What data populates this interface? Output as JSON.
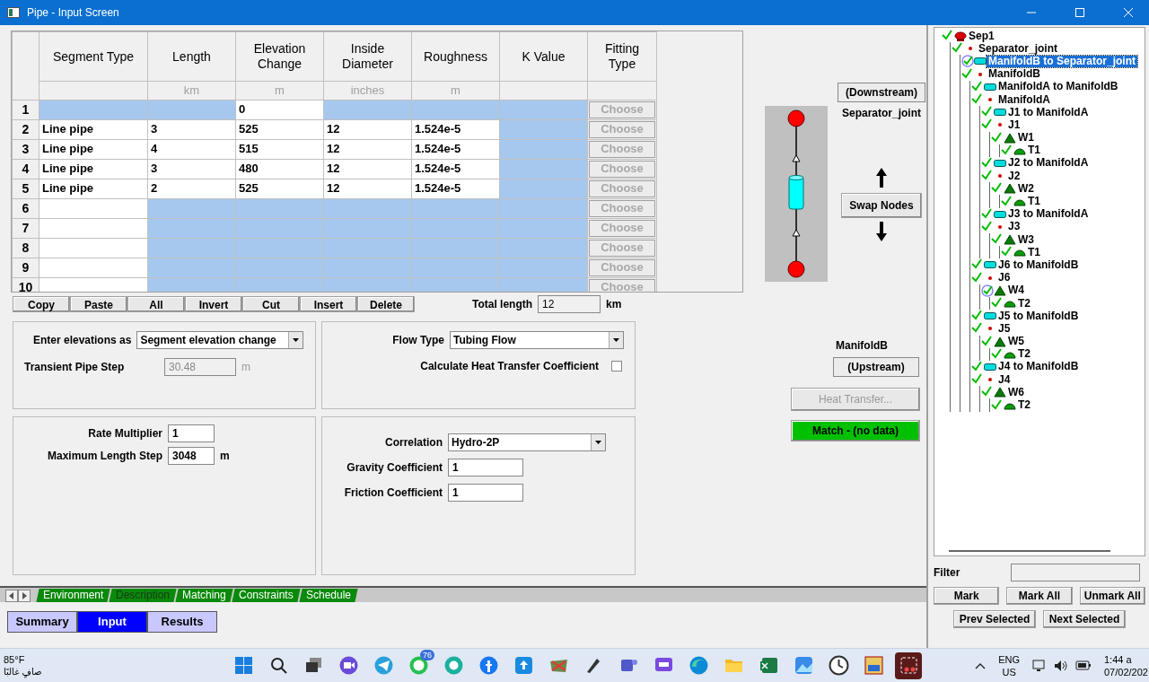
{
  "window": {
    "title": "Pipe - Input Screen"
  },
  "grid": {
    "columns": [
      {
        "title": "Segment Type"
      },
      {
        "title": "Length",
        "unit": "km"
      },
      {
        "title": "Elevation Change",
        "unit": "m"
      },
      {
        "title": "Inside Diameter",
        "unit": "inches"
      },
      {
        "title": "Roughness",
        "unit": "m"
      },
      {
        "title": "K Value"
      },
      {
        "title": "Fitting Type"
      }
    ],
    "rows": [
      {
        "number": "1",
        "cells": [
          {
            "disabled": true
          },
          {
            "disabled": true
          },
          {
            "value": "0",
            "disabled": false
          },
          {
            "disabled": true
          },
          {
            "disabled": true
          },
          {
            "disabled": true
          }
        ],
        "fitting": {
          "label": "Choose",
          "disabled": true
        }
      },
      {
        "number": "2",
        "cells": [
          {
            "value": "Line pipe",
            "disabled": false
          },
          {
            "value": "3",
            "disabled": false
          },
          {
            "value": "525",
            "disabled": false
          },
          {
            "value": "12",
            "disabled": false
          },
          {
            "value": "1.524e-5",
            "disabled": false
          },
          {
            "disabled": true
          }
        ],
        "fitting": {
          "label": "Choose",
          "disabled": true
        }
      },
      {
        "number": "3",
        "cells": [
          {
            "value": "Line pipe",
            "disabled": false
          },
          {
            "value": "4",
            "disabled": false
          },
          {
            "value": "515",
            "disabled": false
          },
          {
            "value": "12",
            "disabled": false
          },
          {
            "value": "1.524e-5",
            "disabled": false
          },
          {
            "disabled": true
          }
        ],
        "fitting": {
          "label": "Choose",
          "disabled": true
        }
      },
      {
        "number": "4",
        "cells": [
          {
            "value": "Line pipe",
            "disabled": false
          },
          {
            "value": "3",
            "disabled": false
          },
          {
            "value": "480",
            "disabled": false
          },
          {
            "value": "12",
            "disabled": false
          },
          {
            "value": "1.524e-5",
            "disabled": false
          },
          {
            "disabled": true
          }
        ],
        "fitting": {
          "label": "Choose",
          "disabled": true
        }
      },
      {
        "number": "5",
        "cells": [
          {
            "value": "Line pipe",
            "disabled": false
          },
          {
            "value": "2",
            "disabled": false
          },
          {
            "value": "525",
            "disabled": false
          },
          {
            "value": "12",
            "disabled": false
          },
          {
            "value": "1.524e-5",
            "disabled": false
          },
          {
            "disabled": true
          }
        ],
        "fitting": {
          "label": "Choose",
          "disabled": true
        }
      },
      {
        "number": "6",
        "cells": [
          {
            "disabled": false
          },
          {
            "disabled": true
          },
          {
            "disabled": true
          },
          {
            "disabled": true
          },
          {
            "disabled": true
          },
          {
            "disabled": true
          }
        ],
        "fitting": {
          "label": "Choose",
          "disabled": true
        }
      },
      {
        "number": "7",
        "cells": [
          {
            "disabled": false
          },
          {
            "disabled": true
          },
          {
            "disabled": true
          },
          {
            "disabled": true
          },
          {
            "disabled": true
          },
          {
            "disabled": true
          }
        ],
        "fitting": {
          "label": "Choose",
          "disabled": true
        }
      },
      {
        "number": "8",
        "cells": [
          {
            "disabled": false
          },
          {
            "disabled": true
          },
          {
            "disabled": true
          },
          {
            "disabled": true
          },
          {
            "disabled": true
          },
          {
            "disabled": true
          }
        ],
        "fitting": {
          "label": "Choose",
          "disabled": true
        }
      },
      {
        "number": "9",
        "cells": [
          {
            "disabled": false
          },
          {
            "disabled": true
          },
          {
            "disabled": true
          },
          {
            "disabled": true
          },
          {
            "disabled": true
          },
          {
            "disabled": true
          }
        ],
        "fitting": {
          "label": "Choose",
          "disabled": true
        }
      },
      {
        "number": "10",
        "cells": [
          {
            "disabled": false
          },
          {
            "disabled": true
          },
          {
            "disabled": true
          },
          {
            "disabled": true
          },
          {
            "disabled": true
          },
          {
            "disabled": true
          }
        ],
        "fitting": {
          "label": "Choose",
          "disabled": true
        }
      }
    ]
  },
  "grid_tools": [
    "Copy",
    "Paste",
    "All",
    "Invert",
    "Cut",
    "Insert",
    "Delete"
  ],
  "total_length": {
    "label": "Total length",
    "value": "12",
    "unit": "km"
  },
  "nodes": {
    "downstream_label": "(Downstream)",
    "downstream": "Separator_joint",
    "swap": "Swap Nodes",
    "upstream": "ManifoldB",
    "upstream_label": "(Upstream)",
    "heat_transfer": {
      "label": "Heat Transfer...",
      "disabled": true
    },
    "match": {
      "label": "Match - (no data)"
    }
  },
  "elevation_panel": {
    "mode_label": "Enter elevations as",
    "mode": "Segment elevation change",
    "step_label": "Transient Pipe Step",
    "step": "30.48",
    "step_unit": "m",
    "step_disabled": true
  },
  "flow_panel": {
    "flow_label": "Flow Type",
    "flow": "Tubing Flow",
    "heat_label": "Calculate Heat Transfer Coefficient",
    "heat_checked": false
  },
  "rate_panel": {
    "rate_label": "Rate Multiplier",
    "rate": "1",
    "step_label": "Maximum Length Step",
    "step": "3048",
    "step_unit": "m"
  },
  "correlation_panel": {
    "correlation_label": "Correlation",
    "correlation": "Hydro-2P",
    "gravity_label": "Gravity Coefficient",
    "gravity": "1",
    "friction_label": "Friction Coefficient",
    "friction": "1"
  },
  "sheet_tabs": [
    {
      "label": "Environment",
      "selected": false
    },
    {
      "label": "Description",
      "selected": true
    },
    {
      "label": "Matching",
      "selected": false
    },
    {
      "label": "Constraints",
      "selected": false
    },
    {
      "label": "Schedule",
      "selected": false
    }
  ],
  "view_buttons": [
    {
      "label": "Summary",
      "selected": false
    },
    {
      "label": "Input",
      "selected": true
    },
    {
      "label": "Results",
      "selected": false
    }
  ],
  "tree": [
    {
      "label": "Sep1",
      "kind": "separator",
      "checked": true,
      "marked": false,
      "selected": false,
      "children": [
        {
          "label": "Separator_joint",
          "kind": "joint",
          "checked": true,
          "marked": false,
          "selected": false,
          "children": [
            {
              "label": "ManifoldB to Separator_joint",
              "kind": "pipe",
              "checked": true,
              "marked": true,
              "selected": true
            },
            {
              "label": "ManifoldB",
              "kind": "joint",
              "checked": true,
              "marked": false,
              "selected": false,
              "children": [
                {
                  "label": "ManifoldA to ManifoldB",
                  "kind": "pipe",
                  "checked": true,
                  "marked": false,
                  "selected": false
                },
                {
                  "label": "ManifoldA",
                  "kind": "joint",
                  "checked": true,
                  "marked": false,
                  "selected": false,
                  "children": [
                    {
                      "label": "J1 to ManifoldA",
                      "kind": "pipe",
                      "checked": true,
                      "marked": false,
                      "selected": false
                    },
                    {
                      "label": "J1",
                      "kind": "joint",
                      "checked": true,
                      "marked": false,
                      "selected": false,
                      "children": [
                        {
                          "label": "W1",
                          "kind": "well",
                          "checked": true,
                          "marked": false,
                          "selected": false,
                          "children": [
                            {
                              "label": "T1",
                              "kind": "tank",
                              "checked": true,
                              "marked": false,
                              "selected": false
                            }
                          ]
                        }
                      ]
                    },
                    {
                      "label": "J2 to ManifoldA",
                      "kind": "pipe",
                      "checked": true,
                      "marked": false,
                      "selected": false
                    },
                    {
                      "label": "J2",
                      "kind": "joint",
                      "checked": true,
                      "marked": false,
                      "selected": false,
                      "children": [
                        {
                          "label": "W2",
                          "kind": "well",
                          "checked": true,
                          "marked": false,
                          "selected": false,
                          "children": [
                            {
                              "label": "T1",
                              "kind": "tank",
                              "checked": true,
                              "marked": false,
                              "selected": false
                            }
                          ]
                        }
                      ]
                    },
                    {
                      "label": "J3 to ManifoldA",
                      "kind": "pipe",
                      "checked": true,
                      "marked": false,
                      "selected": false
                    },
                    {
                      "label": "J3",
                      "kind": "joint",
                      "checked": true,
                      "marked": false,
                      "selected": false,
                      "children": [
                        {
                          "label": "W3",
                          "kind": "well",
                          "checked": true,
                          "marked": false,
                          "selected": false,
                          "children": [
                            {
                              "label": "T1",
                              "kind": "tank",
                              "checked": true,
                              "marked": false,
                              "selected": false
                            }
                          ]
                        }
                      ]
                    }
                  ]
                },
                {
                  "label": "J6 to ManifoldB",
                  "kind": "pipe",
                  "checked": true,
                  "marked": false,
                  "selected": false
                },
                {
                  "label": "J6",
                  "kind": "joint",
                  "checked": true,
                  "marked": false,
                  "selected": false,
                  "children": [
                    {
                      "label": "W4",
                      "kind": "well",
                      "checked": true,
                      "marked": true,
                      "selected": false,
                      "children": [
                        {
                          "label": "T2",
                          "kind": "tank",
                          "checked": true,
                          "marked": false,
                          "selected": false
                        }
                      ]
                    }
                  ]
                },
                {
                  "label": "J5 to ManifoldB",
                  "kind": "pipe",
                  "checked": true,
                  "marked": false,
                  "selected": false
                },
                {
                  "label": "J5",
                  "kind": "joint",
                  "checked": true,
                  "marked": false,
                  "selected": false,
                  "children": [
                    {
                      "label": "W5",
                      "kind": "well",
                      "checked": true,
                      "marked": false,
                      "selected": false,
                      "children": [
                        {
                          "label": "T2",
                          "kind": "tank",
                          "checked": true,
                          "marked": false,
                          "selected": false
                        }
                      ]
                    }
                  ]
                },
                {
                  "label": "J4 to ManifoldB",
                  "kind": "pipe",
                  "checked": true,
                  "marked": false,
                  "selected": false
                },
                {
                  "label": "J4",
                  "kind": "joint",
                  "checked": true,
                  "marked": false,
                  "selected": false,
                  "children": [
                    {
                      "label": "W6",
                      "kind": "well",
                      "checked": true,
                      "marked": false,
                      "selected": false,
                      "children": [
                        {
                          "label": "T2",
                          "kind": "tank",
                          "checked": true,
                          "marked": false,
                          "selected": false
                        }
                      ]
                    }
                  ]
                }
              ]
            }
          ]
        }
      ]
    }
  ],
  "filter": {
    "label": "Filter"
  },
  "tree_buttons": [
    "Mark",
    "Mark All",
    "Unmark All"
  ],
  "selection_buttons": [
    "Prev Selected",
    "Next Selected"
  ],
  "taskbar": {
    "temperature": "85°F",
    "condition": "صافٍ غالبًا",
    "apps": [
      {
        "kind": "start",
        "active": false
      },
      {
        "kind": "search",
        "active": false
      },
      {
        "kind": "taskview",
        "active": false
      },
      {
        "kind": "video",
        "active": false
      },
      {
        "kind": "telegram",
        "active": false
      },
      {
        "kind": "whatsapp",
        "active": false,
        "badge": "76"
      },
      {
        "kind": "profile",
        "active": false
      },
      {
        "kind": "facebook",
        "active": false
      },
      {
        "kind": "cloud",
        "active": false
      },
      {
        "kind": "map",
        "active": false
      },
      {
        "kind": "pen",
        "active": false
      },
      {
        "kind": "teams",
        "active": false
      },
      {
        "kind": "chat",
        "active": false
      },
      {
        "kind": "edge",
        "active": false
      },
      {
        "kind": "folder",
        "active": false
      },
      {
        "kind": "excel",
        "active": false
      },
      {
        "kind": "photos",
        "active": false
      },
      {
        "kind": "clock",
        "active": false
      },
      {
        "kind": "gap",
        "active": false
      },
      {
        "kind": "snip",
        "active": true
      }
    ],
    "language": "ENG",
    "region": "US",
    "time": "1:44 a",
    "date": "07/02/202"
  }
}
